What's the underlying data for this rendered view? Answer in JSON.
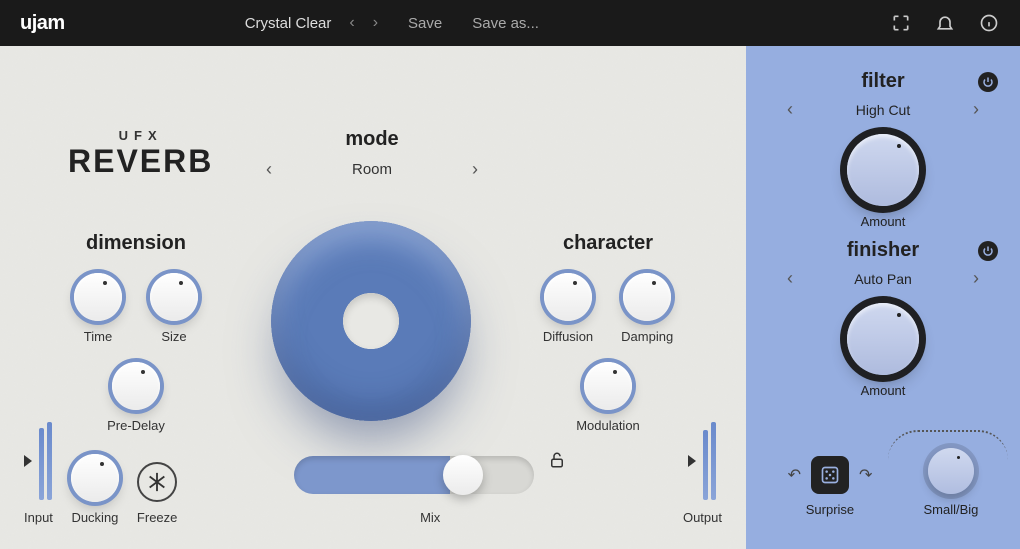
{
  "topbar": {
    "logo": "ujam",
    "preset": "Crystal Clear",
    "save": "Save",
    "save_as": "Save as..."
  },
  "brand": {
    "ufx": "UFX",
    "reverb": "REVERB"
  },
  "mode": {
    "title": "mode",
    "value": "Room"
  },
  "dimension": {
    "title": "dimension",
    "time": "Time",
    "size": "Size",
    "predelay": "Pre-Delay"
  },
  "character": {
    "title": "character",
    "diffusion": "Diffusion",
    "damping": "Damping",
    "modulation": "Modulation"
  },
  "bottom": {
    "input": "Input",
    "ducking": "Ducking",
    "freeze": "Freeze",
    "mix": "Mix",
    "output": "Output"
  },
  "filter": {
    "title": "filter",
    "value": "High Cut",
    "amount": "Amount"
  },
  "finisher": {
    "title": "finisher",
    "value": "Auto Pan",
    "amount": "Amount"
  },
  "surprise": "Surprise",
  "small_big": "Small/Big"
}
